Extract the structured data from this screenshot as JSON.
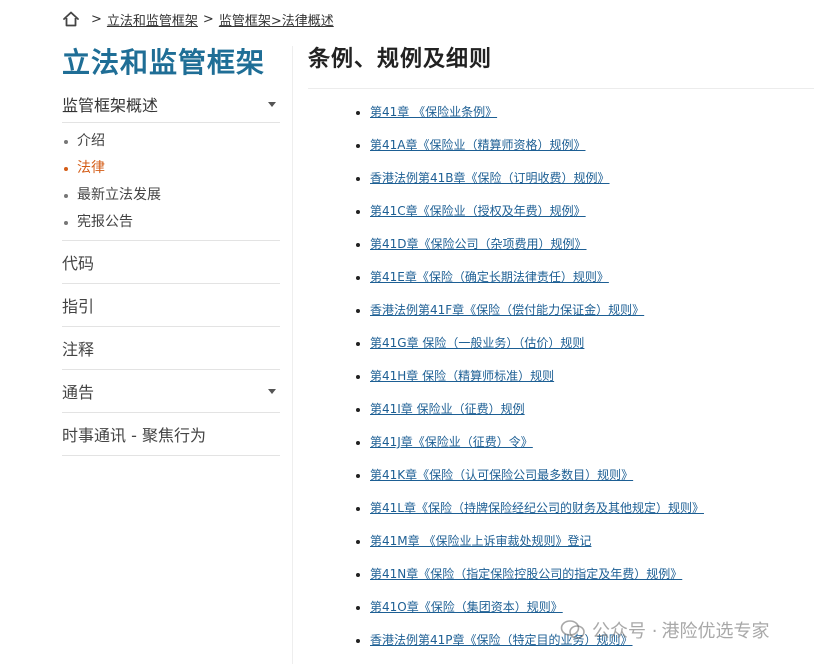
{
  "breadcrumb": {
    "icon": "home-icon",
    "sep1": ">",
    "crumb1": "立法和监管框架",
    "sep2": ">",
    "crumb2": "监管框架>法律概述"
  },
  "sidebar": {
    "title": "立法和监管框架",
    "section_title": "监管框架概述",
    "sub_items": [
      "介绍",
      "法律",
      "最新立法发展",
      "宪报公告"
    ],
    "active_sub_item": "法律",
    "items": [
      {
        "label": "代码",
        "has_caret": false
      },
      {
        "label": "指引",
        "has_caret": false
      },
      {
        "label": "注释",
        "has_caret": false
      },
      {
        "label": "通告",
        "has_caret": true
      },
      {
        "label": "时事通讯 - 聚焦行为",
        "has_caret": false
      }
    ]
  },
  "main": {
    "title": "条例、规例及细则",
    "laws": [
      "第41章 《保险业条例》",
      "第41A章《保险业（精算师资格）规例》",
      "香港法例第41B章《保险（订明收费）规例》",
      "第41C章《保险业（授权及年费）规例》",
      "第41D章《保险公司（杂项费用）规例》",
      "第41E章《保险（确定长期法律责任）规则》",
      "香港法例第41F章《保险（偿付能力保证金）规则》",
      "第41G章 保险（一般业务）（估价）规则",
      "第41H章 保险（精算师标准）规则",
      "第41I章 保险业（征费）规例",
      "第41J章《保险业（征费）令》",
      "第41K章《保险（认可保险公司最多数目）规则》",
      "第41L章《保险（持牌保险经纪公司的财务及其他规定）规则》",
      "第41M章 《保险业上诉审裁处规则》登记",
      "第41N章《保险（指定保险控股公司的指定及年费）规例》",
      "第41O章《保险（集团资本）规则》",
      "香港法例第41P章《保险（特定目的业务）规则》"
    ]
  },
  "watermark": {
    "prefix": "公众号 ·",
    "name": "港险优选专家"
  },
  "colors": {
    "title_blue": "#1f6e96",
    "link_blue": "#1d5f94",
    "active_orange": "#d45d17"
  }
}
